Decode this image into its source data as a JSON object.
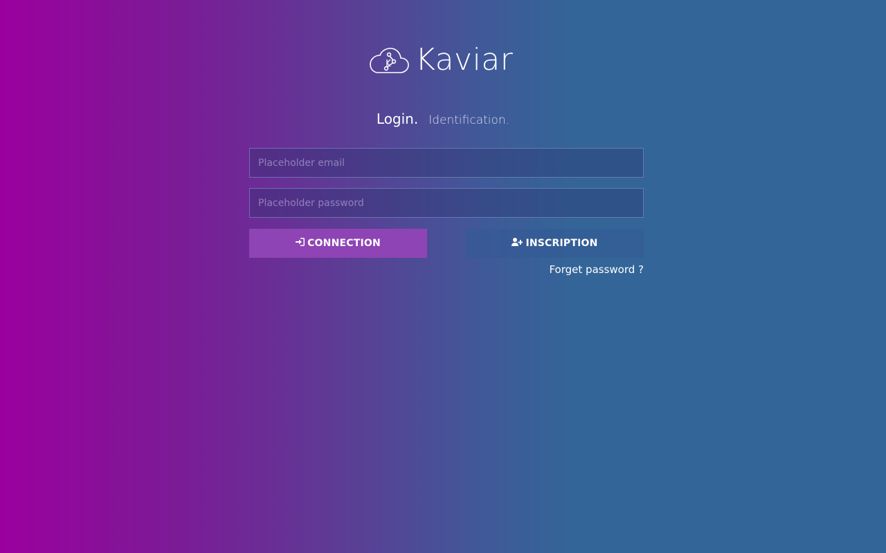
{
  "brand": {
    "name": "Kaviar"
  },
  "heading": {
    "title": "Login.",
    "subtitle": "Identification."
  },
  "form": {
    "email_placeholder": "Placeholder email",
    "password_placeholder": "Placeholder password",
    "connect_label": "CONNECTION",
    "signup_label": "INSCRIPTION",
    "forgot_label": "Forget password ?"
  },
  "icons": {
    "logo": "cloud-network-icon",
    "connect": "sign-in-icon",
    "signup": "user-plus-icon"
  },
  "colors": {
    "gradient_left": "#9b009e",
    "gradient_right": "#336598",
    "connect_button": "#8e44b4"
  }
}
